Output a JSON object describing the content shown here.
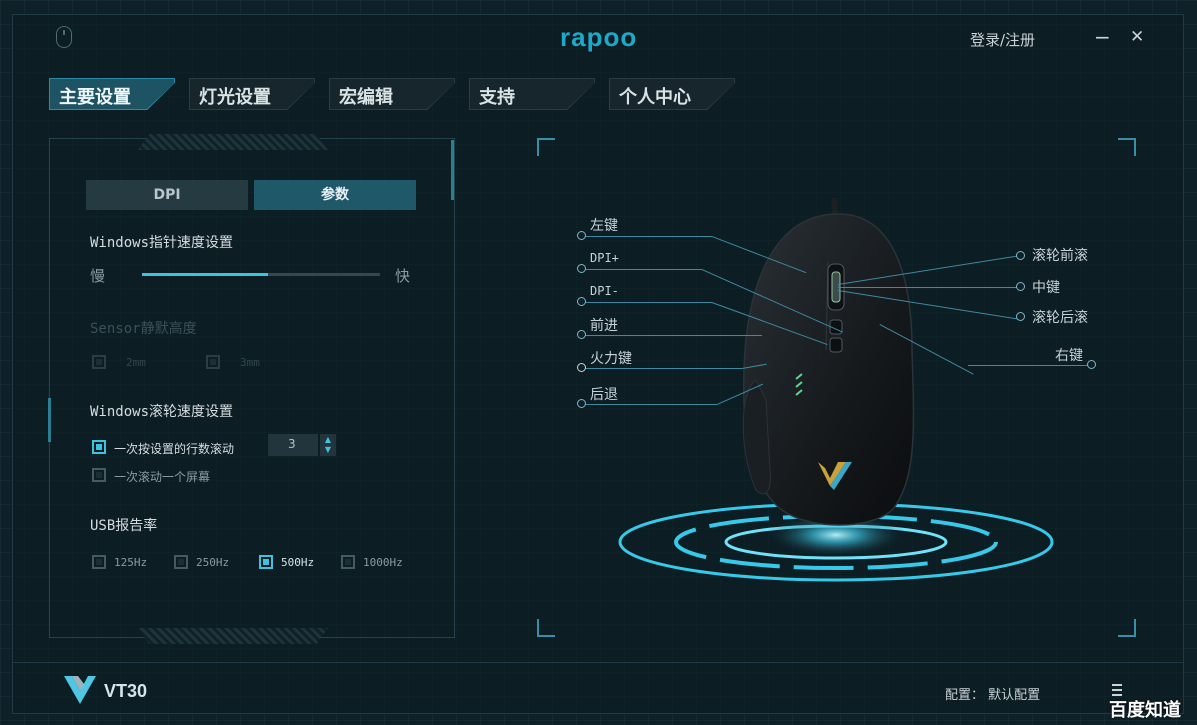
{
  "titlebar": {
    "brand": "rapoo",
    "login": "登录/注册",
    "minimize": "−",
    "close": "✕"
  },
  "tabs": [
    {
      "label": "主要设置",
      "active": true
    },
    {
      "label": "灯光设置",
      "active": false
    },
    {
      "label": "宏编辑",
      "active": false
    },
    {
      "label": "支持",
      "active": false
    },
    {
      "label": "个人中心",
      "active": false
    }
  ],
  "panel": {
    "segments": [
      {
        "label": "DPI",
        "active": false
      },
      {
        "label": "参数",
        "active": true
      }
    ],
    "pointer": {
      "title": "Windows指针速度设置",
      "slow": "慢",
      "fast": "快",
      "level": 0.53
    },
    "sensor": {
      "title": "Sensor静默高度",
      "options": [
        "2mm",
        "3mm"
      ]
    },
    "scroll": {
      "title": "Windows滚轮速度设置",
      "option_lines": "一次按设置的行数滚动",
      "option_screen": "一次滚动一个屏幕",
      "lines_value": "3",
      "up_arrow": "▲",
      "down_arrow": "▼"
    },
    "usb": {
      "title": "USB报告率",
      "options": [
        "125Hz",
        "250Hz",
        "500Hz",
        "1000Hz"
      ],
      "selected": "500Hz"
    }
  },
  "hotspots": {
    "left_button": "左键",
    "dpi_up": "DPI+",
    "dpi_down": "DPI-",
    "forward": "前进",
    "fire": "火力键",
    "back": "后退",
    "scroll_up": "滚轮前滚",
    "middle": "中键",
    "scroll_down": "滚轮后滚",
    "right_button": "右键"
  },
  "bottom": {
    "model": "VT30",
    "config_label": "配置：",
    "config_value": "默认配置"
  },
  "watermark": "百度知道",
  "colors": {
    "accent": "#3fc1e0",
    "brand": "#1fa9c9",
    "background": "#0f2128"
  }
}
